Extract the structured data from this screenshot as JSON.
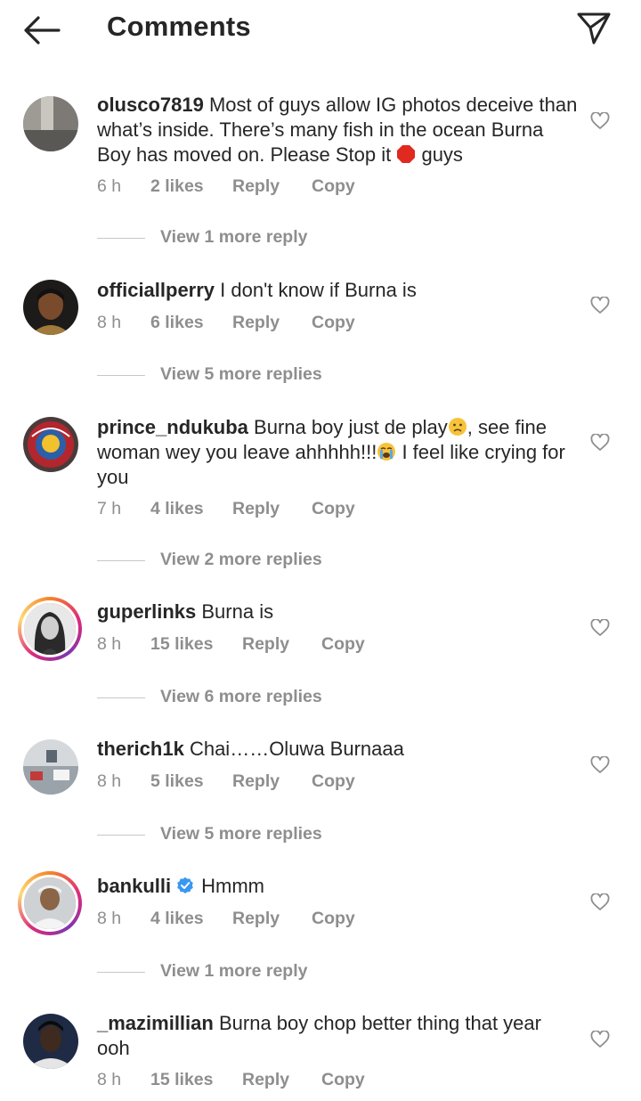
{
  "header": {
    "title": "Comments"
  },
  "actions": {
    "reply": "Reply",
    "copy": "Copy"
  },
  "comments": [
    {
      "username": "olusco7819",
      "text_a": "Most of guys allow IG photos deceive than what’s inside. There’s many fish in the ocean Burna Boy has moved on. Please Stop it",
      "text_b": "guys",
      "time": "6 h",
      "likes": "2 likes",
      "replies": "View 1 more reply"
    },
    {
      "username": "officiallperry",
      "text_a": "I don't know if Burna is",
      "time": "8 h",
      "likes": "6 likes",
      "replies": "View 5 more replies"
    },
    {
      "username": "prince_ndukuba",
      "text_a": "Burna boy just de play",
      "text_b": ", see fine woman wey you leave ahhhhh!!!",
      "text_c": "I feel like crying for you",
      "time": "7 h",
      "likes": "4 likes",
      "replies": "View 2 more replies"
    },
    {
      "username": "guperlinks",
      "text_a": "Burna is",
      "time": "8 h",
      "likes": "15 likes",
      "replies": "View 6 more replies"
    },
    {
      "username": "therich1k",
      "text_a": "Chai……Oluwa Burnaaa",
      "time": "8 h",
      "likes": "5 likes",
      "replies": "View 5 more replies"
    },
    {
      "username": "bankulli",
      "text_a": "Hmmm",
      "time": "8 h",
      "likes": "4 likes",
      "replies": "View 1 more reply"
    },
    {
      "username": "_mazimillian",
      "text_a": "Burna boy chop better thing that year ooh",
      "time": "8 h",
      "likes": "15 likes"
    }
  ],
  "colors": {
    "text": "#262626",
    "muted": "#8e8e8e",
    "verified": "#3897f0",
    "stop_emoji": "#e0291f"
  }
}
